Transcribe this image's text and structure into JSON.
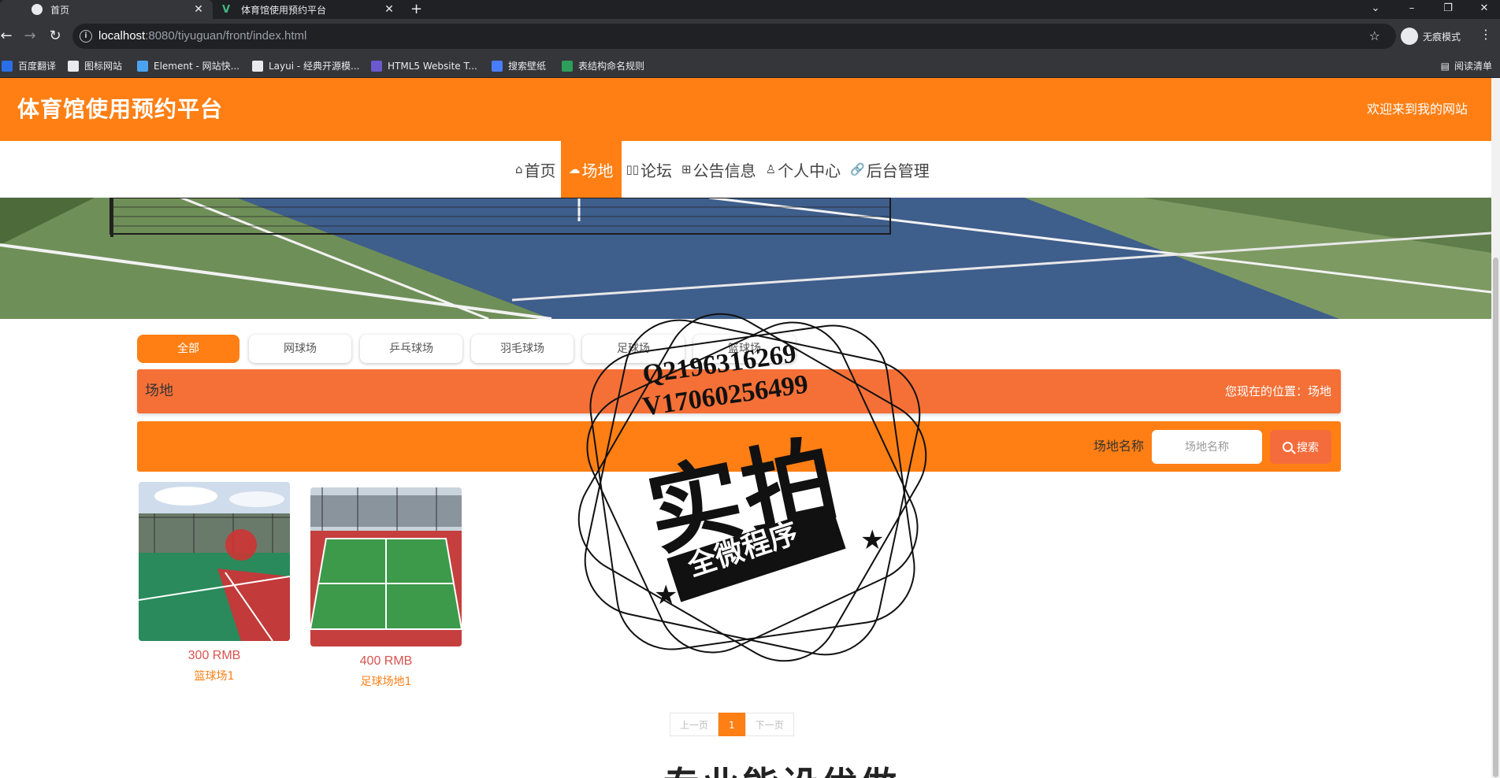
{
  "browser": {
    "tabs": [
      {
        "title": "首页",
        "active": true
      },
      {
        "title": "体育馆使用预约平台",
        "active": false
      }
    ],
    "new_tab": "+",
    "url_host": "localhost",
    "url_rest": ":8080/tiyuguan/front/index.html",
    "incognito_label": "无痕模式",
    "bookmarks": [
      {
        "label": "百度翻译",
        "color": "#2b6fe8"
      },
      {
        "label": "图标网站",
        "color": "#e8eaed"
      },
      {
        "label": "Element - 网站快...",
        "color": "#4ba3f0"
      },
      {
        "label": "Layui - 经典开源模...",
        "color": "#e8eaed"
      },
      {
        "label": "HTML5 Website T...",
        "color": "#6a5acd"
      },
      {
        "label": "搜索壁纸",
        "color": "#4a7dfc"
      },
      {
        "label": "表结构命名规则",
        "color": "#2e9e5b"
      }
    ],
    "reading_list": "阅读清单"
  },
  "site": {
    "title": "体育馆使用预约平台",
    "welcome": "欢迎来到我的网站",
    "accent_color": "#ff7f14",
    "nav": [
      {
        "label": "首页",
        "icon": "home-icon",
        "glyph": "⌂",
        "active": false
      },
      {
        "label": "场地",
        "icon": "cloud-icon",
        "glyph": "☁",
        "active": true
      },
      {
        "label": "论坛",
        "icon": "forum-icon",
        "glyph": "▯▯",
        "active": false
      },
      {
        "label": "公告信息",
        "icon": "notice-icon",
        "glyph": "⊞",
        "active": false
      },
      {
        "label": "个人中心",
        "icon": "user-icon",
        "glyph": "♙",
        "active": false
      },
      {
        "label": "后台管理",
        "icon": "link-icon",
        "glyph": "🔗",
        "active": false
      }
    ]
  },
  "categories": [
    {
      "label": "全部",
      "active": true
    },
    {
      "label": "网球场",
      "active": false
    },
    {
      "label": "乒乓球场",
      "active": false
    },
    {
      "label": "羽毛球场",
      "active": false
    },
    {
      "label": "足球场",
      "active": false
    },
    {
      "label": "篮球场",
      "active": false
    }
  ],
  "section": {
    "title": "场地",
    "breadcrumb": "您现在的位置：场地"
  },
  "search": {
    "label": "场地名称",
    "placeholder": "场地名称",
    "button": "搜索"
  },
  "venues": [
    {
      "price": "300 RMB",
      "name": "篮球场1"
    },
    {
      "price": "400 RMB",
      "name": "足球场地1"
    }
  ],
  "pagination": {
    "prev": "上一页",
    "current": "1",
    "next": "下一页"
  },
  "bottom_heading": "专业能设优做",
  "watermark": {
    "line1": "Q2196316269",
    "line2": "V17060256499",
    "big": "实拍",
    "ribbon": "全微程序"
  }
}
